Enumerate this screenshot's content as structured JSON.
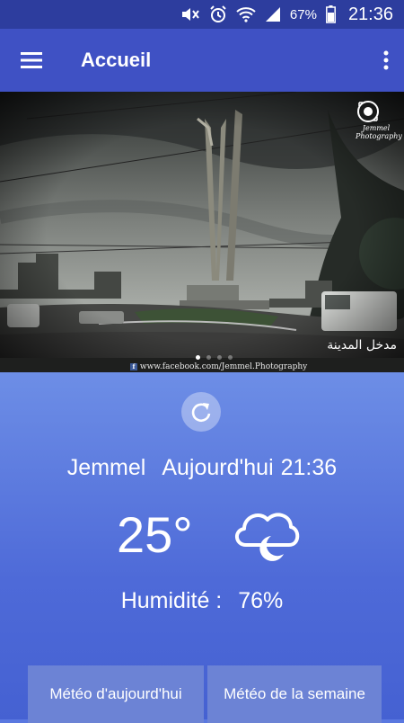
{
  "status_bar": {
    "battery": "67%",
    "time": "21:36"
  },
  "app_bar": {
    "title": "Accueil"
  },
  "banner": {
    "caption": "مدخل المدينة",
    "credit": "www.facebook.com/Jemmel.Photography",
    "watermark_line1": "Jemmel",
    "watermark_line2": "Photography",
    "slide_count": 4,
    "active_slide": 1
  },
  "weather": {
    "city": "Jemmel",
    "day": "Aujourd'hui",
    "time": "21:36",
    "temperature": "25°",
    "condition_icon": "cloud-moon-icon",
    "humidity_label": "Humidité :",
    "humidity_value": "76%"
  },
  "buttons": {
    "today": "Météo d'aujourd'hui",
    "week": "Météo de la semaine"
  },
  "colors": {
    "status_bar": "#2d3d9e",
    "app_bar": "#3f51c4",
    "accent": "#5a78e0",
    "button": "#6c83d5"
  }
}
